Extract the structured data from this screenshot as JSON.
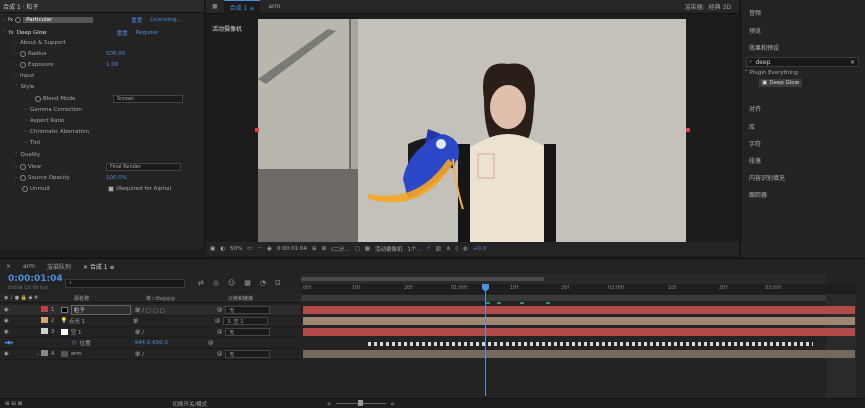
{
  "effects_panel": {
    "title": "合成 1 · 粒子",
    "particular": {
      "name": "Particular",
      "reset": "重置",
      "link": "Licensing..."
    },
    "deep_glow": {
      "name": "Deep Glow",
      "reset": "重置",
      "link": "Register"
    },
    "about": "About & Support",
    "radius": {
      "label": "Radius",
      "value": "500.00"
    },
    "exposure": {
      "label": "Exposure",
      "value": "1.00"
    },
    "input": "Input",
    "style": "Style",
    "blend_mode": {
      "label": "Blend Mode",
      "value": "Screen"
    },
    "gamma": "Gamma Correction",
    "aspect": "Aspect Ratio",
    "chromatic": "Chromatic Aberration",
    "tint": "Tint",
    "quality": "Quality",
    "view": {
      "label": "View",
      "value": "Final Render"
    },
    "source_opacity": {
      "label": "Source Opacity",
      "value": "100.0%"
    },
    "unmult": {
      "label": "Unmult",
      "value": "(Required for Alpha)"
    }
  },
  "comp_panel": {
    "tab": "合成 1",
    "crumb": "arm",
    "renderer_label": "渲染器:",
    "renderer_value": "经典 3D",
    "camera_label": "活动摄像机",
    "zoom": "50%",
    "timecode": "0:00:01:04",
    "resolution": "(二分...",
    "camera_select": "活动摄像机",
    "views": "1个...",
    "exposure_value": "+0.0"
  },
  "right_panel": {
    "items": [
      "音频",
      "预览",
      "效果和预设",
      "对齐",
      "库",
      "字符",
      "段落",
      "内容识别填充",
      "跟踪器"
    ],
    "search_value": "deep",
    "tree_parent": "Plugin Everything",
    "tree_child": "Deep Glow"
  },
  "timeline": {
    "tabs": [
      "arm",
      "渲染队列",
      "合成 1"
    ],
    "timecode": "0:00:01:04",
    "frame_info": "00028 (25.00 fps)",
    "col_layer": "源名称",
    "col_switches": "单☆\\fx◎◎◎",
    "col_parent": "父级和链接",
    "layers": [
      {
        "num": "1",
        "name": "粒子",
        "parent": "无",
        "color": "#c04040"
      },
      {
        "num": "2",
        "name": "点光 1",
        "parent": "3. 空 1",
        "color": "#d4a574"
      },
      {
        "num": "3",
        "name": "空 1",
        "parent": "无",
        "color": "#d0d0d0"
      },
      {
        "num": "",
        "name": "位置",
        "parent": "",
        "color": ""
      },
      {
        "num": "4",
        "name": "arm",
        "parent": "无",
        "color": "#888888"
      }
    ],
    "position_value": "944.0,650.0",
    "ruler": [
      "00f",
      "10f",
      "20f",
      "01:00f",
      "10f",
      "20f",
      "02:00f",
      "10f",
      "20f",
      "03:00f"
    ],
    "footer_label": "切换开关/模式"
  },
  "colors": {
    "accent": "#2d8ceb",
    "bar_red": "#b24a4a",
    "bar_tan": "#9e8673",
    "playhead": "#4d90e0"
  }
}
